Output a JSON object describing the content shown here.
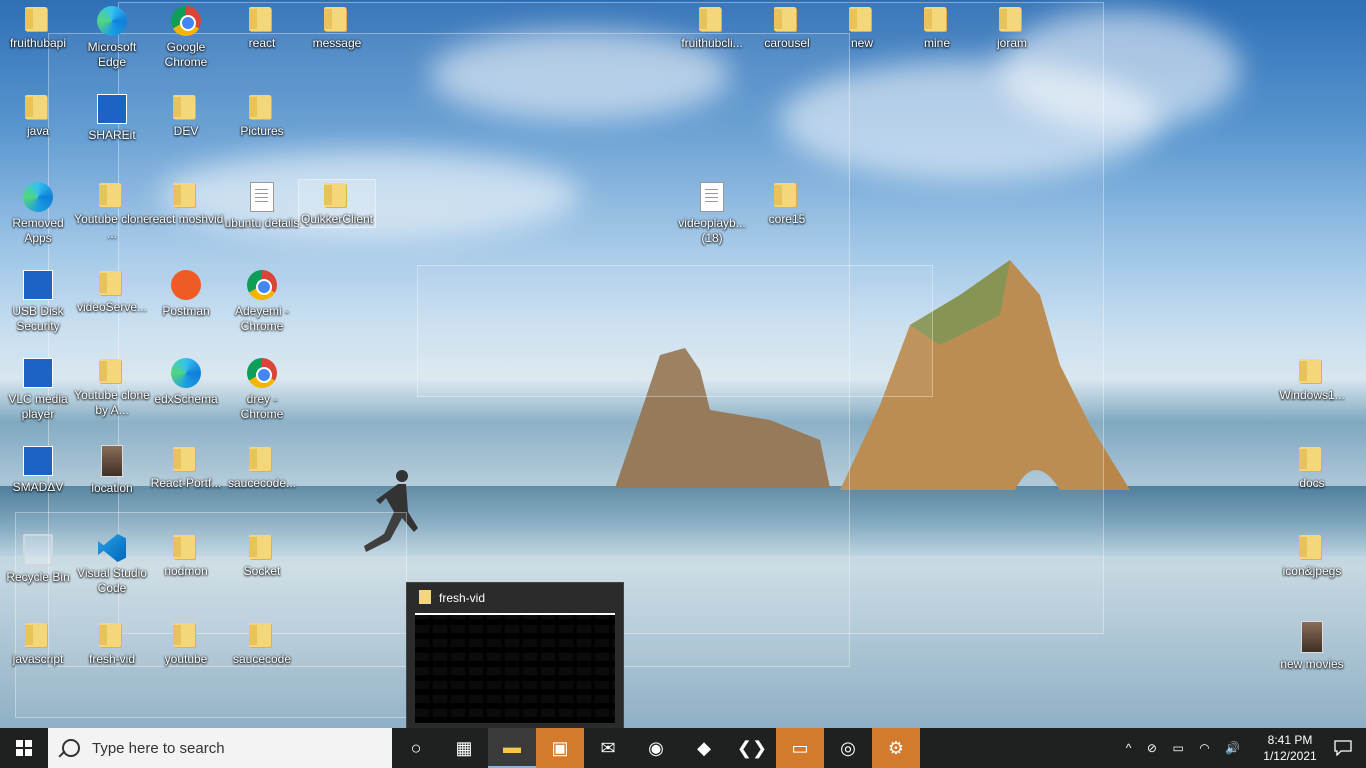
{
  "desktop_icons": [
    {
      "label": "fruithubapi",
      "type": "folder"
    },
    {
      "label": "Microsoft Edge",
      "type": "edge"
    },
    {
      "label": "Google Chrome",
      "type": "chrome"
    },
    {
      "label": "react",
      "type": "folder"
    },
    {
      "label": "message",
      "type": "folder"
    },
    {
      "label": "fruithubcli...",
      "type": "folder"
    },
    {
      "label": "carousel",
      "type": "folder"
    },
    {
      "label": "new",
      "type": "folder"
    },
    {
      "label": "mine",
      "type": "folder"
    },
    {
      "label": "joram",
      "type": "folder"
    },
    {
      "label": "java",
      "type": "folder"
    },
    {
      "label": "SHAREit",
      "type": "shortcut"
    },
    {
      "label": "DEV",
      "type": "folder"
    },
    {
      "label": "Pictures",
      "type": "folder"
    },
    {
      "label": "Removed Apps",
      "type": "edge"
    },
    {
      "label": "Youtube clone ...",
      "type": "folder"
    },
    {
      "label": "react moshvid",
      "type": "folder"
    },
    {
      "label": "ubuntu details",
      "type": "doc"
    },
    {
      "label": "QuikkerClient",
      "type": "folder"
    },
    {
      "label": "videoplayb... (18)",
      "type": "doc"
    },
    {
      "label": "core15",
      "type": "folder"
    },
    {
      "label": "USB Disk Security",
      "type": "shortcut"
    },
    {
      "label": "videoServe...",
      "type": "folder"
    },
    {
      "label": "Postman",
      "type": "postman"
    },
    {
      "label": "Adeyemi - Chrome",
      "type": "chrome"
    },
    {
      "label": "VLC media player",
      "type": "shortcut"
    },
    {
      "label": "Youtube clone by A...",
      "type": "folder"
    },
    {
      "label": "edxSchema",
      "type": "edge"
    },
    {
      "label": "drey - Chrome",
      "type": "chrome"
    },
    {
      "label": "Windows1...",
      "type": "folder"
    },
    {
      "label": "SMADΔV",
      "type": "shortcut"
    },
    {
      "label": "location",
      "type": "photo"
    },
    {
      "label": "React-Portf...",
      "type": "folder"
    },
    {
      "label": "saucecode...",
      "type": "folder"
    },
    {
      "label": "docs",
      "type": "folder"
    },
    {
      "label": "Recycle Bin",
      "type": "recycle"
    },
    {
      "label": "Visual Studio Code",
      "type": "vscode"
    },
    {
      "label": "nodmon",
      "type": "folder"
    },
    {
      "label": "Socket",
      "type": "folder"
    },
    {
      "label": "icon&jpegs",
      "type": "folder"
    },
    {
      "label": "javascript",
      "type": "folder"
    },
    {
      "label": "fresh-vid",
      "type": "folder"
    },
    {
      "label": "youtube",
      "type": "folder"
    },
    {
      "label": "saucecode",
      "type": "folder"
    },
    {
      "label": "new movies",
      "type": "photo"
    }
  ],
  "preview": {
    "title": "fresh-vid"
  },
  "taskbar": {
    "search_placeholder": "Type here to search",
    "pinned": [
      {
        "name": "cortana-icon",
        "glyph": "○"
      },
      {
        "name": "task-view-icon",
        "glyph": "▦"
      },
      {
        "name": "file-explorer-icon",
        "glyph": "▬",
        "active": true
      },
      {
        "name": "store-icon",
        "glyph": "▣",
        "orange": true
      },
      {
        "name": "mail-icon",
        "glyph": "✉"
      },
      {
        "name": "edge-icon",
        "glyph": "◉"
      },
      {
        "name": "app-icon",
        "glyph": "◆"
      },
      {
        "name": "vscode-icon",
        "glyph": "❮❯"
      },
      {
        "name": "remote-icon",
        "glyph": "▭",
        "orange": true
      },
      {
        "name": "chrome-icon",
        "glyph": "◎"
      },
      {
        "name": "settings-icon",
        "glyph": "⚙",
        "orange": true
      }
    ],
    "tray_icons": [
      "^",
      "⊘",
      "▭",
      "◠",
      "🔊"
    ],
    "time": "8:41 PM",
    "date": "1/12/2021"
  }
}
